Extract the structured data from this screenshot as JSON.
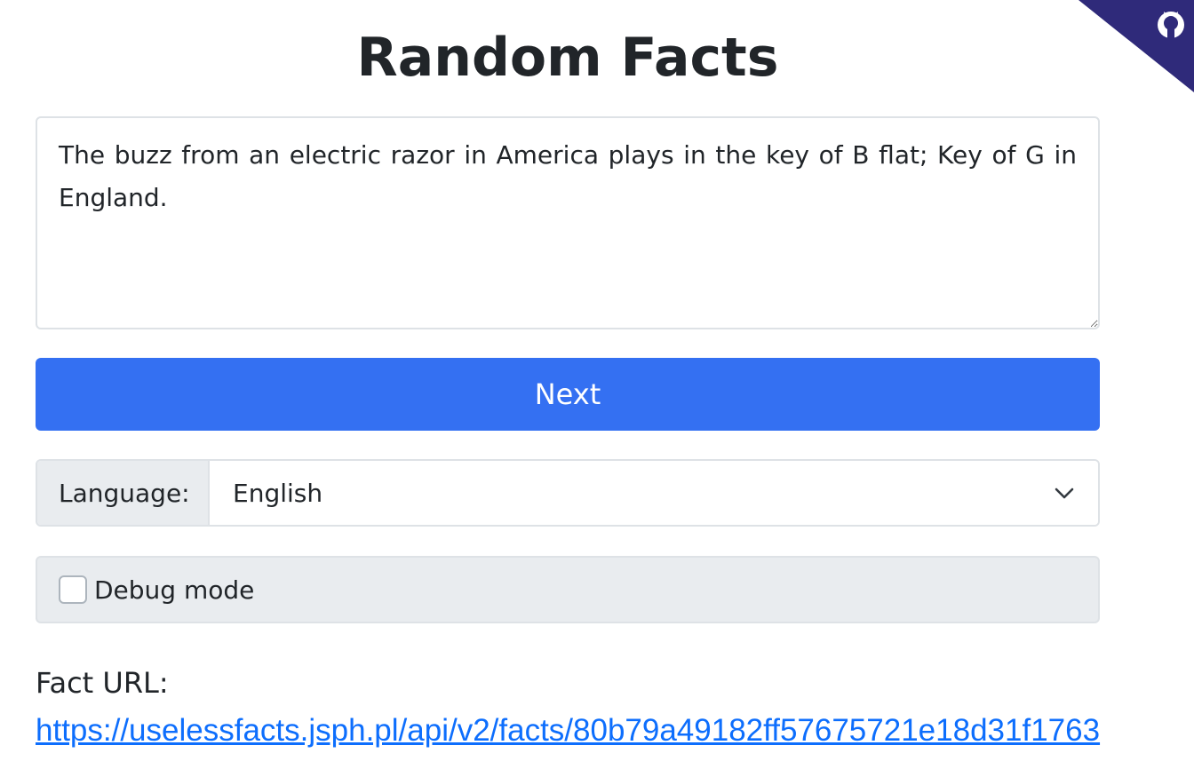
{
  "page": {
    "title": "Random Facts"
  },
  "fact": {
    "text": "The buzz from an electric razor in America plays in the key of B flat; Key of G in England."
  },
  "actions": {
    "next_label": "Next"
  },
  "language": {
    "label": "Language:",
    "selected": "English"
  },
  "debug": {
    "label": "Debug mode",
    "checked": false
  },
  "fact_url": {
    "label": "Fact URL:",
    "url": "https://uselessfacts.jsph.pl/api/v2/facts/80b79a49182ff57675721e18d31f1763"
  },
  "icons": {
    "corner": "github-icon",
    "language_dropdown": "chevron-down-icon"
  },
  "colors": {
    "primary": "#3470f2",
    "link": "#0d6efd",
    "corner_banner": "#2f2a7a",
    "group_background": "#e9ecef"
  }
}
